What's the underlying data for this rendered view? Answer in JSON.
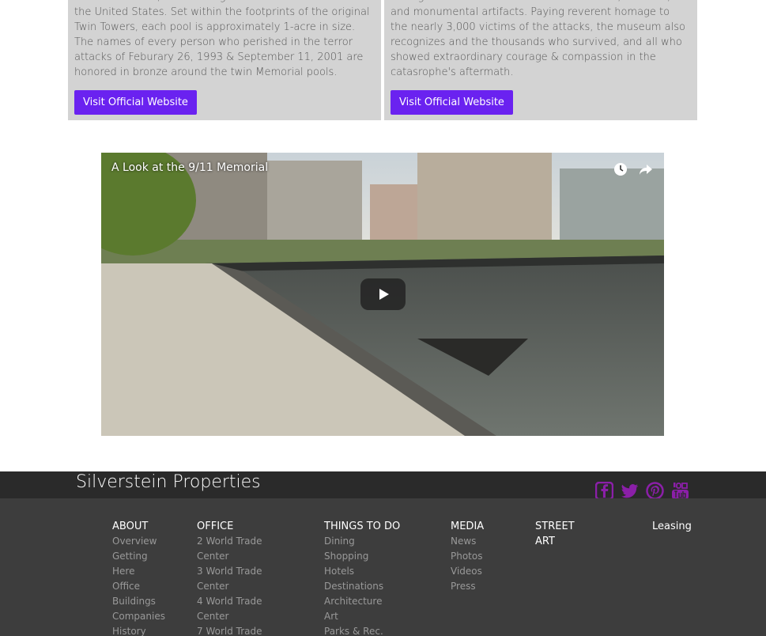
{
  "cards": [
    {
      "text": "White Oak trees, and the largest man-made waterfalls in the United States. Set within the footprints of the original Twin Towers, each pool is approximately 1-acre in size. The names of every person who perished in the terror attacks of Feburary 26, 1993 & September 11, 2001 are honored in bronze around the twin Memorial pools.",
      "button": "Visit Official Website"
    },
    {
      "text": "through state-of-the-art multimedia exhibits, archives, and monumental artifacts. Paying reverent homage to the nearly 3,000 victims of the attacks, the museum also recognizes and the thousands who survived, and all who showed extraordinary courage & compassion in the catasrophe's aftermath.",
      "button": "Visit Official Website"
    }
  ],
  "video": {
    "title": "A Look at the 9/11 Memorial"
  },
  "footer": {
    "brand": "Silverstein Properties",
    "social": [
      "facebook-icon",
      "twitter-icon",
      "pinterest-icon",
      "youtube-icon"
    ],
    "accent": "#8b1fa8",
    "columns": [
      {
        "heading": "ABOUT",
        "items": [
          "Overview",
          "Getting",
          "Here",
          "Office",
          "Buildings",
          "Companies",
          "History"
        ]
      },
      {
        "heading": "OFFICE",
        "items": [
          "2 World Trade",
          "Center",
          "3 World Trade",
          "Center",
          "4 World Trade",
          "Center",
          "7 World Trade"
        ]
      },
      {
        "heading": "THINGS TO DO",
        "items": [
          "Dining",
          "Shopping",
          "Hotels",
          "Destinations",
          "Architecture",
          "Art",
          "Parks & Rec."
        ]
      },
      {
        "heading": "MEDIA",
        "items": [
          "News",
          "Photos",
          "Videos",
          "Press"
        ]
      },
      {
        "heading_line1": "STREET",
        "heading_line2": "ART",
        "items": []
      },
      {
        "heading": "Leasing",
        "items": []
      }
    ]
  },
  "colors": {
    "button": "#6a22f0",
    "card_bg": "#d3d3d3",
    "footer_bar": "#2a2a2a",
    "footer_body": "#3d3d3d"
  }
}
